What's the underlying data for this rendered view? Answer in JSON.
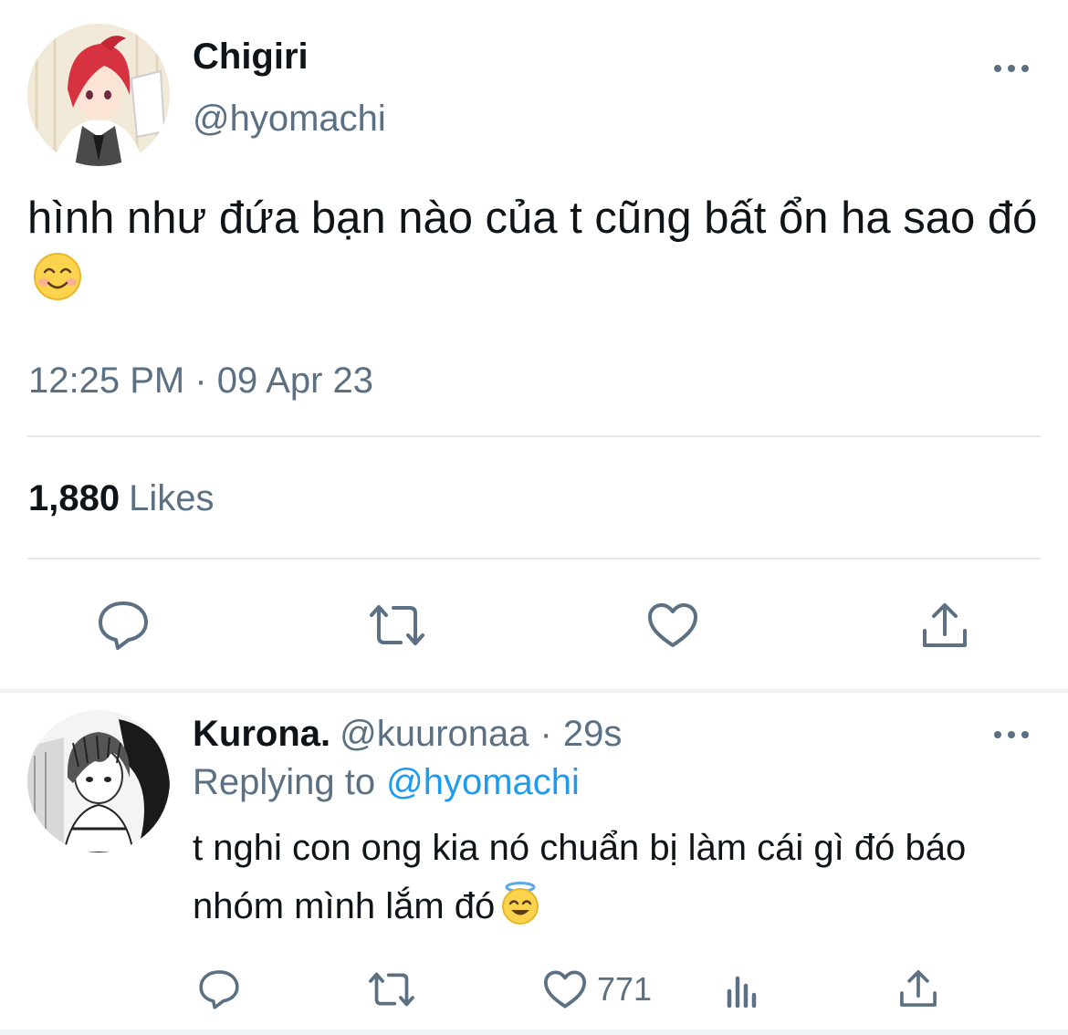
{
  "colors": {
    "text": "#0f1419",
    "secondary": "#5b7083",
    "link": "#1d9bf0",
    "divider": "#e3e7ea"
  },
  "tweet": {
    "display_name": "Chigiri",
    "handle": "@hyomachi",
    "more_icon": "more-horizontal-icon",
    "text": "hình như đứa bạn nào của t cũng bất ổn ha sao đó",
    "emoji": "smiling-face-icon",
    "timestamp": "12:25 PM · 09 Apr 23",
    "likes_count": "1,880",
    "likes_label": "Likes",
    "actions": [
      "reply-icon",
      "retweet-icon",
      "like-icon",
      "share-icon"
    ]
  },
  "reply": {
    "display_name": "Kurona.",
    "handle": "@kuuronaa",
    "separator": "·",
    "time": "29s",
    "replying_label": "Replying to",
    "replying_handle": "@hyomachi",
    "text": "t nghi con ong kia nó chuẩn bị làm cái gì đó báo nhóm mình lắm đó",
    "emoji": "smiling-face-with-halo-icon",
    "like_count": "771",
    "actions": [
      "reply-icon",
      "retweet-icon",
      "like-icon",
      "analytics-icon",
      "share-icon"
    ]
  }
}
